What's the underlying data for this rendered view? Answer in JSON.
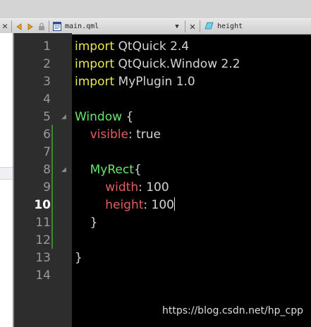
{
  "tabbar": {
    "file_name": "main.qml",
    "symbol_name": "height"
  },
  "editor": {
    "current_line": 10,
    "lines": [
      {
        "num": "1",
        "tokens": [
          {
            "t": "import",
            "c": "kw"
          },
          {
            "t": " QtQuick 2.4",
            "c": "plain"
          }
        ]
      },
      {
        "num": "2",
        "tokens": [
          {
            "t": "import",
            "c": "kw"
          },
          {
            "t": " QtQuick.Window 2.2",
            "c": "plain"
          }
        ]
      },
      {
        "num": "3",
        "tokens": [
          {
            "t": "import",
            "c": "kw"
          },
          {
            "t": " MyPlugin 1.0",
            "c": "plain"
          }
        ]
      },
      {
        "num": "4",
        "tokens": []
      },
      {
        "num": "5",
        "tokens": [
          {
            "t": "Window",
            "c": "type"
          },
          {
            "t": " {",
            "c": "plain"
          }
        ]
      },
      {
        "num": "6",
        "tokens": [
          {
            "t": "    visible",
            "c": "prop"
          },
          {
            "t": ": true",
            "c": "plain"
          }
        ]
      },
      {
        "num": "7",
        "tokens": []
      },
      {
        "num": "8",
        "tokens": [
          {
            "t": "    MyRect",
            "c": "type"
          },
          {
            "t": "{",
            "c": "plain"
          }
        ]
      },
      {
        "num": "9",
        "tokens": [
          {
            "t": "        width",
            "c": "prop"
          },
          {
            "t": ": 100",
            "c": "plain"
          }
        ]
      },
      {
        "num": "10",
        "tokens": [
          {
            "t": "        height",
            "c": "prop"
          },
          {
            "t": ": 100",
            "c": "plain"
          }
        ]
      },
      {
        "num": "11",
        "tokens": [
          {
            "t": "    }",
            "c": "plain"
          }
        ]
      },
      {
        "num": "12",
        "tokens": []
      },
      {
        "num": "13",
        "tokens": [
          {
            "t": "}",
            "c": "plain"
          }
        ]
      },
      {
        "num": "14",
        "tokens": []
      }
    ]
  },
  "watermark": "https://blog.csdn.net/hp_cpp",
  "colors": {
    "keyword": "#e8e84a",
    "type": "#68e868",
    "property": "#e25f5f",
    "text": "#d4d4d4",
    "gutter": "#2d2d2d",
    "background": "#000000"
  }
}
